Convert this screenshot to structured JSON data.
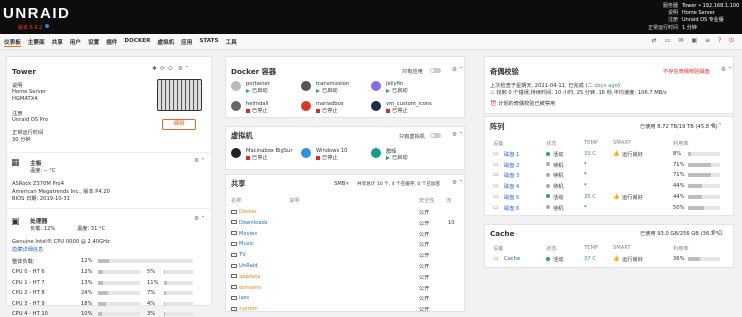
{
  "header": {
    "logo": "UNRAID",
    "version": "版本 6.9.2",
    "server_labels": [
      "服务器",
      "说明",
      "注册",
      "正常运行时间"
    ],
    "server_values": [
      "Tower • 192.168.1.100",
      "Home Server",
      "Unraid OS 专业版",
      "1 分钟"
    ]
  },
  "nav": {
    "tabs": [
      "仪表板",
      "主要面",
      "共享",
      "用户",
      "设置",
      "插件",
      "DOCKER",
      "虚拟机",
      "应用",
      "STATS",
      "工具"
    ]
  },
  "tower": {
    "title": "Tower",
    "info": [
      {
        "label": "说明",
        "values": [
          "Home Server",
          "HGMATX4"
        ]
      },
      {
        "label": "注册",
        "values": [
          "Unraid OS Pro"
        ]
      },
      {
        "label": "正常运行时间",
        "values": [
          "30 分钟"
        ]
      }
    ],
    "edit_button": "编辑"
  },
  "motherboard": {
    "title": "主板",
    "temp": "温度: -- °C",
    "lines": [
      "ASRock Z370M Pro4",
      "American Megatrends Inc., 版本 P4.20",
      "BIOS 日期: 2019-10-31"
    ]
  },
  "processor": {
    "title": "处理器",
    "load": "负载: 12%",
    "temp": "温度: 31 °C",
    "model": "Genuine Intel® CPU 0000 @ 2.40GHz",
    "toggle_link": "隐藏详细信息",
    "overall_label": "整体负载:",
    "overall_pct": "12%",
    "overall_val": 12,
    "threads": [
      {
        "l": "CPU 0 - HT 6",
        "a": "12%",
        "av": 12,
        "b": "5%",
        "bv": 5
      },
      {
        "l": "CPU 1 - HT 7",
        "a": "13%",
        "av": 13,
        "b": "11%",
        "bv": 11
      },
      {
        "l": "CPU 2 - HT 8",
        "a": "24%",
        "av": 24,
        "b": "7%",
        "bv": 7
      },
      {
        "l": "CPU 3 - HT 9",
        "a": "18%",
        "av": 18,
        "b": "4%",
        "bv": 4
      },
      {
        "l": "CPU 4 - HT 10",
        "a": "10%",
        "av": 10,
        "b": "3%",
        "bv": 3
      }
    ]
  },
  "docker": {
    "title": "Docker 容器",
    "autostart": "只有应用",
    "containers": [
      {
        "name": "portainer",
        "state": "已启动",
        "running": true
      },
      {
        "name": "transmission",
        "state": "已启动",
        "running": true
      },
      {
        "name": "jellyfin",
        "state": "已启动",
        "running": true
      },
      {
        "name": "heimdall",
        "state": "已停止",
        "running": false
      },
      {
        "name": "mariadbox",
        "state": "已停止",
        "running": false
      },
      {
        "name": "vm_custom_icons",
        "state": "已停止",
        "running": false
      }
    ]
  },
  "vms": {
    "title": "虚拟机",
    "autostart": "只有虚拟机",
    "list": [
      {
        "name": "Macinabox BigSur",
        "state": "已停止",
        "running": false
      },
      {
        "name": "Windows 10",
        "state": "已停止",
        "running": false
      },
      {
        "name": "群晖",
        "state": "已启动",
        "running": true
      }
    ]
  },
  "shares": {
    "title": "共享",
    "filter": "SMB",
    "summary": "共享总计 10 个, 4 个在缓存, 0 个已加密",
    "headers": [
      "名称",
      "说明",
      "安全性",
      "流"
    ],
    "rows": [
      {
        "n": "Docker",
        "s": "公开",
        "c": "",
        "o": true
      },
      {
        "n": "Downloads",
        "s": "公开",
        "c": "10",
        "o": false
      },
      {
        "n": "Movies",
        "s": "公开",
        "c": "",
        "o": false
      },
      {
        "n": "Music",
        "s": "公开",
        "c": "",
        "o": false
      },
      {
        "n": "TV",
        "s": "公开",
        "c": "",
        "o": false
      },
      {
        "n": "UnRaid",
        "s": "公开",
        "c": "",
        "o": false
      },
      {
        "n": "appdata",
        "s": "公开",
        "c": "",
        "o": true
      },
      {
        "n": "domains",
        "s": "公开",
        "c": "",
        "o": true
      },
      {
        "n": "isos",
        "s": "公开",
        "c": "",
        "o": false
      },
      {
        "n": "system",
        "s": "公开",
        "c": "",
        "o": true
      }
    ]
  },
  "parity": {
    "title": "奇偶校验",
    "warn": "不存在奇偶校验磁盘",
    "last": "上次检查于星期天, 2021-04-11, 已完成 (",
    "days": "二 days ago",
    "last2": ")",
    "line2": "找到 0 个错误,持续时间: 10 小时, 25 分钟, 16 秒,平均速度: 106.7 MB/s",
    "line3": "计划的奇偶校验已被禁用"
  },
  "array": {
    "title": "阵列",
    "usage": "已使用 8.72 TB/19 TB (45.8 %)",
    "headers": [
      "设备",
      "状态",
      "TEMP",
      "SMART",
      "利用率"
    ],
    "rows": [
      {
        "n": "磁盘 1",
        "st": "活动",
        "on": true,
        "t": "33 C",
        "sm": "运行良好",
        "pct": "8%",
        "v": 8
      },
      {
        "n": "磁盘 2",
        "st": "待机",
        "on": false,
        "t": "*",
        "sm": "",
        "pct": "71%",
        "v": 71
      },
      {
        "n": "磁盘 3",
        "st": "待机",
        "on": false,
        "t": "*",
        "sm": "",
        "pct": "71%",
        "v": 71
      },
      {
        "n": "磁盘 4",
        "st": "待机",
        "on": false,
        "t": "*",
        "sm": "",
        "pct": "44%",
        "v": 44
      },
      {
        "n": "磁盘 5",
        "st": "活动",
        "on": true,
        "t": "35 C",
        "sm": "运行良好",
        "pct": "44%",
        "v": 44
      },
      {
        "n": "磁盘 6",
        "st": "待机",
        "on": false,
        "t": "*",
        "sm": "",
        "pct": "50%",
        "v": 50
      }
    ]
  },
  "cache": {
    "title": "Cache",
    "usage": "已使用 93.0 GB/256 GB (36.3 %)",
    "headers": [
      "设备",
      "状态",
      "TEMP",
      "SMART",
      "利用率"
    ],
    "rows": [
      {
        "n": "Cache",
        "st": "活动",
        "t": "37 C",
        "sm": "运行良好",
        "pct": "36%",
        "v": 36
      }
    ]
  }
}
